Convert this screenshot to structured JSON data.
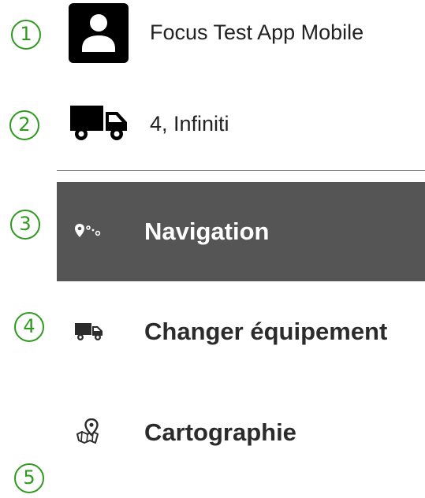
{
  "callouts": [
    "1",
    "2",
    "3",
    "4",
    "5"
  ],
  "header": {
    "user_name": "Focus Test App Mobile",
    "vehicle_name": "4, Infiniti"
  },
  "menu": {
    "items": [
      {
        "label": "Navigation",
        "icon": "route-pin-icon",
        "selected": true
      },
      {
        "label": "Changer équipement",
        "icon": "truck-icon",
        "selected": false
      },
      {
        "label": "Cartographie",
        "icon": "map-pin-icon",
        "selected": false
      }
    ]
  },
  "colors": {
    "callout": "#2e9a1e",
    "selected_bg": "#555555",
    "divider": "#777777"
  }
}
